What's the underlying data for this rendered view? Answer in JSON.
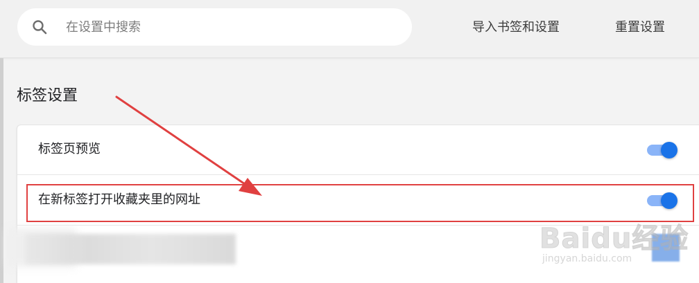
{
  "header": {
    "search": {
      "placeholder": "在设置中搜索",
      "value": ""
    },
    "import_label": "导入书签和设置",
    "reset_label": "重置设置"
  },
  "section": {
    "title": "标签设置",
    "items": [
      {
        "label": "标签页预览",
        "enabled": true
      },
      {
        "label": "在新标签打开收藏夹里的网址",
        "enabled": true
      }
    ]
  },
  "watermark": {
    "brand": "Baidu经验",
    "url": "jingyan.baidu.com"
  },
  "colors": {
    "toggle_on": "#1a73e8",
    "toggle_track": "#8ab4f8",
    "annotation_red": "#e04040"
  },
  "icons": {
    "search": "search-icon",
    "arrow": "annotation-arrow-icon"
  }
}
